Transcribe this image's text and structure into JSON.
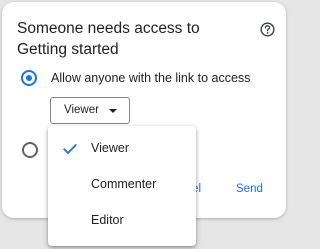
{
  "dialog": {
    "title": "Someone needs access to Getting started",
    "help_icon": "help-circle-icon",
    "options": [
      {
        "label": "Allow anyone with the link to access",
        "selected": true
      },
      {
        "label": "",
        "selected": false
      }
    ],
    "role_select": {
      "value": "Viewer",
      "icon": "dropdown-caret-icon"
    },
    "footer": {
      "cancel_label_visible": "el",
      "send_label": "Send"
    }
  },
  "menu": {
    "items": [
      {
        "label": "Viewer",
        "checked": true,
        "icon": "checkmark-icon"
      },
      {
        "label": "Commenter",
        "checked": false
      },
      {
        "label": "Editor",
        "checked": false
      }
    ]
  },
  "colors": {
    "accent": "#1a73e8",
    "text": "#202124",
    "background": "#e6e6e6"
  }
}
